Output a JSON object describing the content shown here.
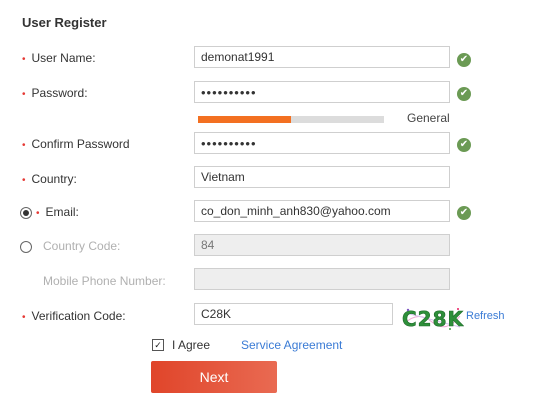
{
  "title": "User Register",
  "form": {
    "username": {
      "label": "User Name:",
      "value": "demonat1991"
    },
    "password": {
      "label": "Password:",
      "value": "••••••••••"
    },
    "strength": {
      "label": "General",
      "level": 0.5
    },
    "confirm": {
      "label": "Confirm Password",
      "value": "••••••••••"
    },
    "country": {
      "label": "Country:",
      "value": "Vietnam"
    },
    "email": {
      "label": "Email:",
      "value": "co_don_minh_anh830@yahoo.com"
    },
    "country_code": {
      "label": "Country Code:",
      "value": "84"
    },
    "mobile": {
      "label": "Mobile Phone Number:",
      "value": ""
    },
    "verification": {
      "label": "Verification Code:",
      "value": "C28K"
    },
    "captcha_text": "C28K",
    "refresh_label": "Refresh"
  },
  "agree": {
    "label": "I Agree",
    "link": "Service Agreement",
    "checked": true
  },
  "next_label": "Next",
  "colors": {
    "accent": "#e0452a",
    "ok": "#6b9a54",
    "link": "#3a7bd5",
    "strength": "#f37021"
  },
  "icons": {
    "ok": "check-circle-icon",
    "required": "asterisk-icon"
  }
}
